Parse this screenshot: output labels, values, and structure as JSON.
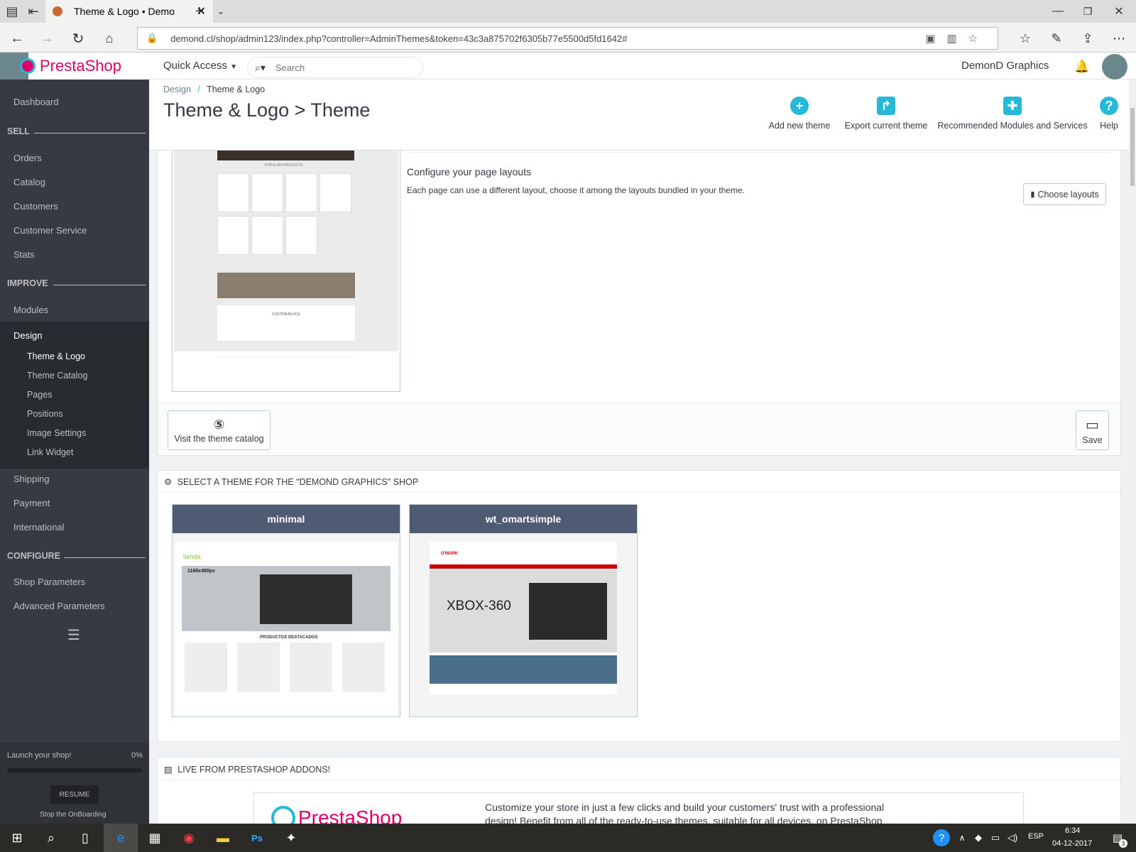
{
  "browser": {
    "tab_title": "Theme & Logo • Demo",
    "url": "demond.cl/shop/admin123/index.php?controller=AdminThemes&token=43c3a875702f6305b77e5500d5fd1642#"
  },
  "header": {
    "logo_text": "PrestaShop",
    "quick_access": "Quick Access",
    "search_placeholder": "Search",
    "shop_name": "DemonD Graphics"
  },
  "sidebar": {
    "dashboard": "Dashboard",
    "sell": "SELL",
    "orders": "Orders",
    "catalog": "Catalog",
    "customers": "Customers",
    "customer_service": "Customer Service",
    "stats": "Stats",
    "improve": "IMPROVE",
    "modules": "Modules",
    "design": "Design",
    "design_sub": [
      "Theme & Logo",
      "Theme Catalog",
      "Pages",
      "Positions",
      "Image Settings",
      "Link Widget"
    ],
    "shipping": "Shipping",
    "payment": "Payment",
    "international": "International",
    "configure": "CONFIGURE",
    "shop_parameters": "Shop Parameters",
    "advanced_parameters": "Advanced Parameters",
    "launch_label": "Launch your shop!",
    "launch_percent": "0%",
    "launch_progress": 0,
    "resume": "RESUME",
    "stop_onboarding": "Stop the OnBoarding"
  },
  "page": {
    "breadcrumb_1": "Design",
    "breadcrumb_sep": "/",
    "breadcrumb_2": "Theme & Logo",
    "title": "Theme & Logo > Theme",
    "toolbar": {
      "add": "Add new theme",
      "export": "Export current theme",
      "recommended": "Recommended Modules and Services",
      "help": "Help"
    }
  },
  "layouts": {
    "heading": "Configure your page layouts",
    "description": "Each page can use a different layout, choose it among the layouts bundled in your theme.",
    "button": "Choose layouts"
  },
  "preview_labels": {
    "popular": "POPULAR PRODUCTS",
    "custom": "CUSTOM BLOCK"
  },
  "footer_buttons": {
    "catalog": "Visit the theme catalog",
    "save": "Save"
  },
  "select_theme": {
    "heading": "SELECT A THEME FOR THE \"DEMOND GRAPHICS\" SHOP",
    "themes": [
      {
        "name": "minimal",
        "preview_text_1": "1168x480px",
        "preview_text_2": "PRODUCTOS DESTACADOS",
        "preview_text_3": "tienda"
      },
      {
        "name": "wt_omartsimple",
        "preview_text_1": "XBOX-360",
        "preview_text_2": "O'MARK"
      }
    ]
  },
  "addons": {
    "heading": "LIVE FROM PRESTASHOP ADDONS!",
    "logo": "PrestaShop",
    "text_1": "Customize your store in just a few clicks and build your customers' trust with a professional",
    "text_2": "design! Benefit from all of the ready-to-use themes, suitable for all devices, on PrestaShop"
  },
  "taskbar": {
    "lang": "ESP",
    "time": "6:34",
    "date": "04-12-2017",
    "notif": "3"
  },
  "colors": {
    "sidebar_bg": "#363a41",
    "accent": "#25b9d7",
    "theme_title_bg": "#4f5a73"
  }
}
